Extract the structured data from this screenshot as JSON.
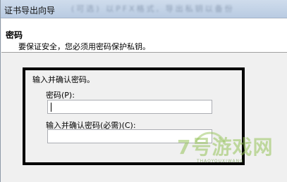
{
  "window": {
    "title": "证书导出向导",
    "title_obscured_text": "(可选)  以PFX格式, 导出私钥以备份"
  },
  "header": {
    "title": "密码",
    "subtitle": "要保证安全，您必须用密码保护私钥。"
  },
  "form": {
    "instruction": "输入并确认密码。",
    "password_label": "密码(P):",
    "password_value": "",
    "confirm_label": "输入并确认密码(必需)(C):",
    "confirm_value": ""
  },
  "watermark": {
    "text": "7号游戏网",
    "sub": "THAOYOUXIWANG"
  },
  "colors": {
    "titlebar": "#c4d5ea",
    "highlight_frame": "#000000",
    "watermark": "#96c35a"
  }
}
